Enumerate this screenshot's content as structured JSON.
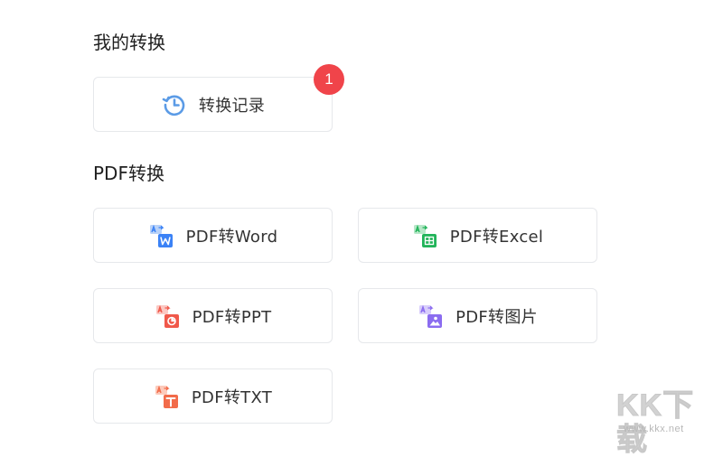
{
  "my_conversion": {
    "title": "我的转换",
    "record_button": {
      "label": "转换记录",
      "badge_count": "1"
    }
  },
  "pdf_conversion": {
    "title": "PDF转换",
    "items": [
      {
        "label": "PDF转Word",
        "icon": "pdf-to-word-icon",
        "color": "#3b82f6"
      },
      {
        "label": "PDF转Excel",
        "icon": "pdf-to-excel-icon",
        "color": "#22b45a"
      },
      {
        "label": "PDF转PPT",
        "icon": "pdf-to-ppt-icon",
        "color": "#f0584a"
      },
      {
        "label": "PDF转图片",
        "icon": "pdf-to-image-icon",
        "color": "#8b6cf0"
      },
      {
        "label": "PDF转TXT",
        "icon": "pdf-to-txt-icon",
        "color": "#f26b4a"
      }
    ]
  },
  "watermark": {
    "brand": "KK下载",
    "url": "www.kkx.net"
  },
  "colors": {
    "badge": "#f0444a",
    "history_icon": "#5b9be6",
    "card_border": "#e6e8eb"
  }
}
